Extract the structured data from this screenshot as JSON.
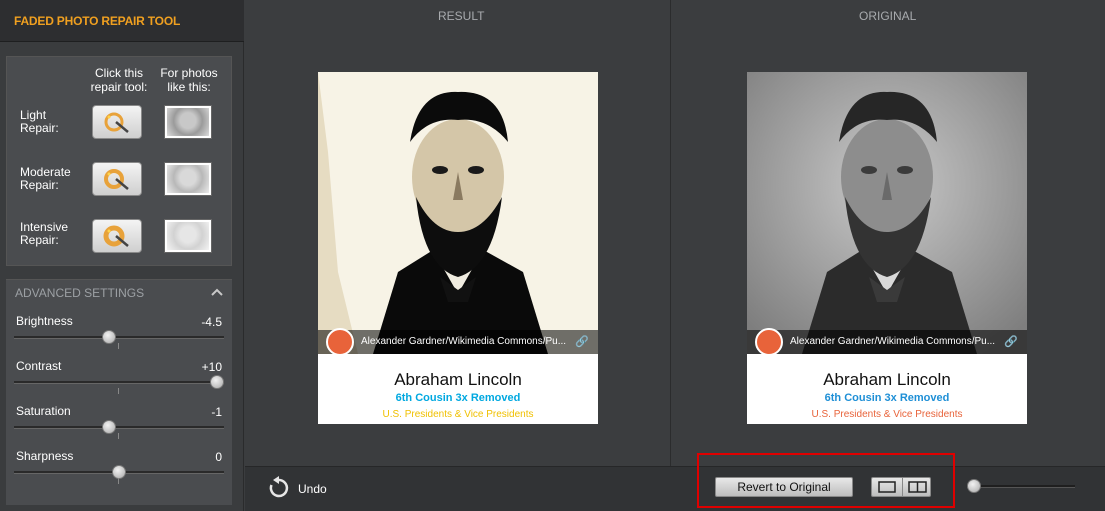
{
  "app": {
    "title": "FADED PHOTO REPAIR TOOL"
  },
  "repair": {
    "col_tool": "Click this repair tool:",
    "col_photos": "For photos like this:",
    "rows": [
      {
        "label": "Light Repair:",
        "icon": "magic-wand-light-icon"
      },
      {
        "label": "Moderate Repair:",
        "icon": "magic-wand-moderate-icon"
      },
      {
        "label": "Intensive Repair:",
        "icon": "magic-wand-intensive-icon"
      }
    ]
  },
  "advanced": {
    "title": "ADVANCED SETTINGS",
    "sliders": [
      {
        "label": "Brightness",
        "value": "-4.5",
        "level": 0.45
      },
      {
        "label": "Contrast",
        "value": "+10",
        "level": 1.0
      },
      {
        "label": "Saturation",
        "value": "-1",
        "level": 0.45
      },
      {
        "label": "Sharpness",
        "value": "0",
        "level": 0.5
      }
    ]
  },
  "panes": {
    "result": {
      "title": "RESULT"
    },
    "original": {
      "title": "ORIGINAL"
    }
  },
  "card": {
    "credit": "Alexander Gardner/Wikimedia Commons/Pu...",
    "name": "Abraham Lincoln",
    "relation": "6th Cousin 3x Removed",
    "group": "U.S. Presidents & Vice Presidents"
  },
  "toolbar": {
    "undo": "Undo",
    "revert": "Revert to Original",
    "zoom_level": 0.05
  },
  "colors": {
    "accent": "#f0a020",
    "relation_result": "#00a8e0",
    "relation_original": "#1e8fd6",
    "group_result": "#f0c000",
    "group_original": "#e8633a",
    "highlight": "#e00000"
  }
}
